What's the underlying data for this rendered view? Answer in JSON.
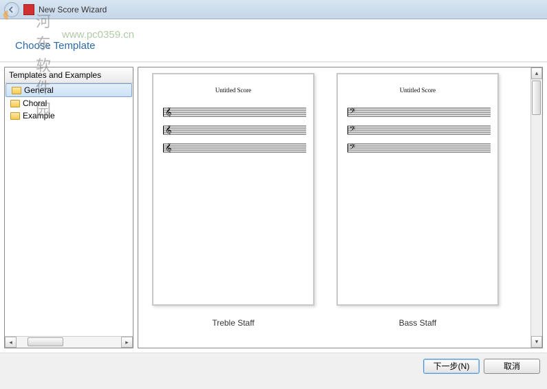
{
  "window": {
    "title": "New Score Wizard"
  },
  "watermark": {
    "site_name": "河东软件园",
    "url": "www.pc0359.cn"
  },
  "header": {
    "title": "Choose Template"
  },
  "tree": {
    "header": "Templates and Examples",
    "items": [
      {
        "label": "General",
        "selected": true
      },
      {
        "label": "Choral",
        "selected": false
      },
      {
        "label": "Example",
        "selected": false
      }
    ]
  },
  "templates": [
    {
      "score_title": "Untitled Score",
      "label": "Treble Staff",
      "clef": "treble"
    },
    {
      "score_title": "Untitled Score",
      "label": "Bass Staff",
      "clef": "bass"
    }
  ],
  "footer": {
    "next_label": "下一步(N)",
    "cancel_label": "取消"
  }
}
